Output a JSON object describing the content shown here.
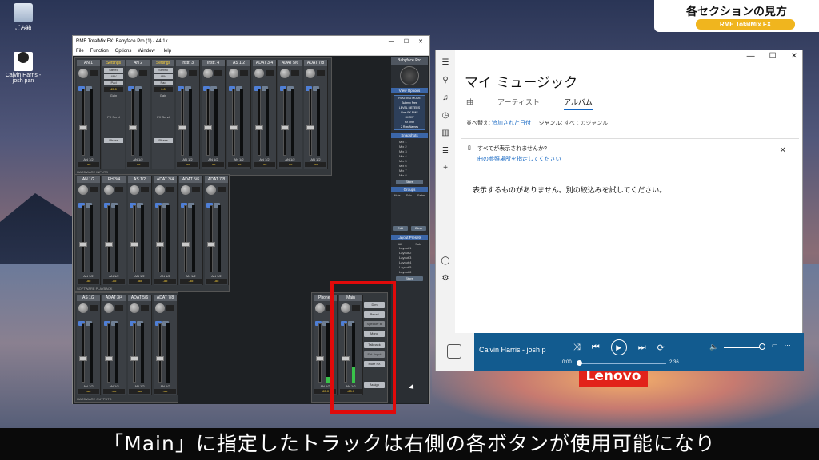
{
  "banner": {
    "title": "各セクションの見方",
    "subtitle": "RME TotalMix FX"
  },
  "caption": "「Main」に指定したトラックは右側の各ボタンが使用可能になり",
  "desktop": {
    "icons": [
      {
        "label": "ごみ箱",
        "icon": "recycle-bin-icon"
      },
      {
        "label": "Calvin Harris - josh pan",
        "icon": "audio-file-icon"
      }
    ],
    "brand": "Lenovo"
  },
  "totalmix": {
    "title": "RME TotalMix FX: Babyface Pro (1) - 44.1k",
    "menu": [
      "File",
      "Function",
      "Options",
      "Window",
      "Help"
    ],
    "inputs": {
      "channels": [
        "AN 1",
        "AN 2",
        "Instr. 3",
        "Instr. 4",
        "AS 1/2",
        "ADAT 3/4",
        "ADAT 5/6",
        "ADAT 7/8"
      ],
      "settings_label": "Settings",
      "settings_buttons": [
        "Stereo",
        "48V",
        "Pad"
      ],
      "gain_values": [
        "45.0",
        "0.0"
      ],
      "gain_label": "Gain",
      "fx_send": "FX Send",
      "phase": "Phase",
      "fader_value": "-oo",
      "routing": "AN 1/2",
      "row_label": "HARDWARE INPUTS"
    },
    "playback": {
      "channels": [
        "AN 1/2",
        "PH 3/4",
        "AS 1/2",
        "ADAT 3/4",
        "ADAT 5/6",
        "ADAT 7/8"
      ],
      "row_label": "SOFTWARE PLAYBACK"
    },
    "outputs": {
      "channels": [
        "AS 1/2",
        "ADAT 3/4",
        "ADAT 5/6",
        "ADAT 7/8",
        "Phones",
        "Main"
      ],
      "main_value": "-65.0",
      "phones_value": "-65.0",
      "row_label": "HARDWARE OUTPUTS",
      "main_buttons": [
        "Dim",
        "Recall",
        "Speaker B",
        "Mono",
        "Talkback",
        "Ext. Input",
        "Mute FX",
        "Assign"
      ]
    },
    "right_panel": {
      "device": "Babyface Pro",
      "view_options": "View Options",
      "routing_mode": "ROUTING MODE",
      "routing_opts": [
        "Submix",
        "Free"
      ],
      "level_meters": "LEVEL METERS",
      "level_opts": [
        "Post FX",
        "RMS"
      ],
      "show": "SHOW",
      "show_opts": [
        "FX",
        "Trim",
        "2 Row",
        "Names"
      ],
      "snapshots": "Snapshots",
      "snapshot_items": [
        "Mix 1",
        "Mix 2",
        "Mix 3",
        "Mix 4",
        "Mix 5",
        "Mix 6",
        "Mix 7",
        "Mix 8"
      ],
      "store": "Store",
      "groups": "Groups",
      "groups_header": [
        "Mute",
        "Solo",
        "Fader"
      ],
      "edit": "Edit",
      "clear": "Clear",
      "layout_presets": "Layout Presets",
      "layout_tabs": [
        "All",
        "Sub"
      ],
      "layout_items": [
        "Layout 1",
        "Layout 2",
        "Layout 3",
        "Layout 4",
        "Layout 5",
        "Layout 6"
      ]
    }
  },
  "music": {
    "title": "マイ ミュージック",
    "tabs": [
      "曲",
      "アーティスト",
      "アルバム"
    ],
    "active_tab": "アルバム",
    "sort_label": "並べ替え:",
    "sort_value": "追加された日付",
    "genre_label": "ジャンル:",
    "genre_value": "すべてのジャンル",
    "note_q": "すべてが表示されませんか?",
    "note_link": "曲の参照場所を指定してください",
    "empty": "表示するものがありません。別の絞込みを試してください。",
    "player": {
      "song": "Calvin Harris - josh p",
      "time_current": "0:00",
      "time_total": "2:36",
      "progress": 0.0
    }
  }
}
